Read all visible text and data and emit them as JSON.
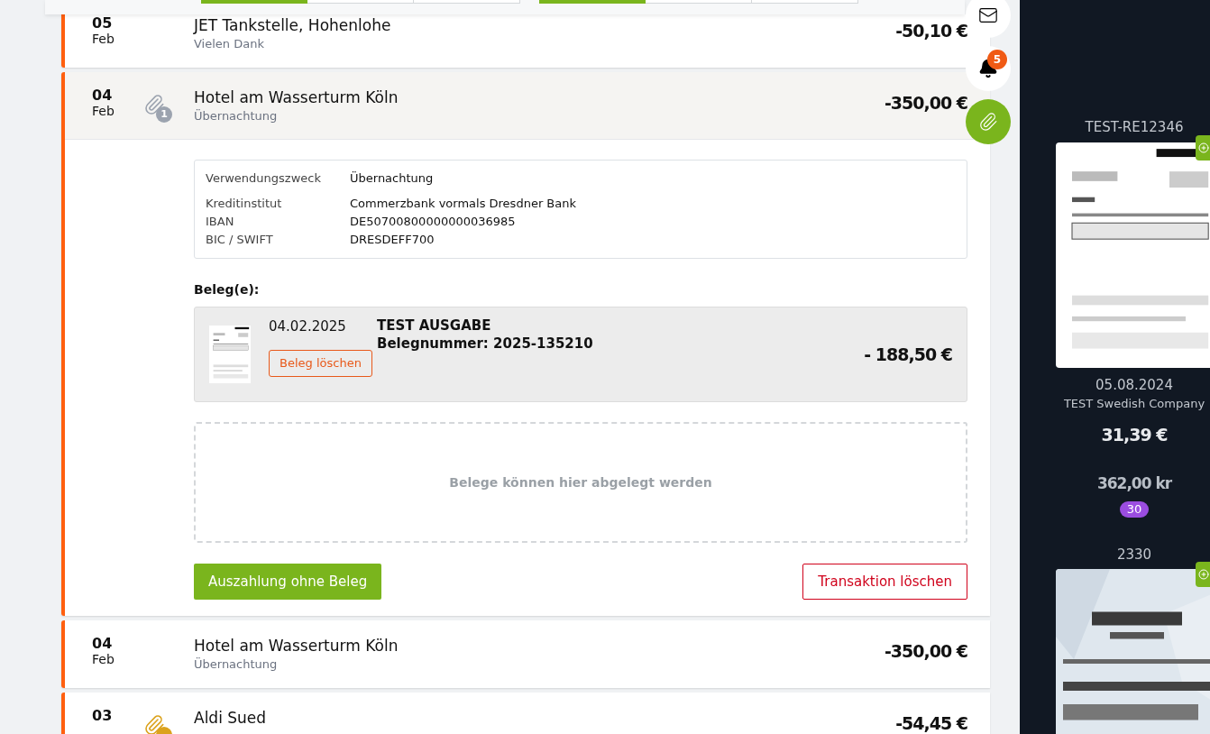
{
  "toolbar": {
    "groups": [
      {
        "segments": [
          {
            "selected": true
          },
          {
            "selected": false
          },
          {
            "selected": false
          }
        ]
      },
      {
        "segments": [
          {
            "selected": true
          },
          {
            "selected": false
          },
          {
            "selected": false
          }
        ]
      }
    ]
  },
  "transactions": [
    {
      "kind": "collapsed",
      "day": "05",
      "month": "Feb",
      "title": "JET Tankstelle, Hohenlohe",
      "subtitle": "Vielen Dank",
      "amount": "-50,10 €"
    },
    {
      "kind": "expanded",
      "day": "04",
      "month": "Feb",
      "title": "Hotel am Wasserturm Köln",
      "subtitle": "Übernachtung",
      "amount": "-350,00 €",
      "attachment": {
        "count": "1",
        "color": "#9ca3af"
      },
      "details": [
        {
          "label": "Verwendungszweck",
          "value": "Übernachtung"
        },
        {
          "label": "Kreditinstitut",
          "value": "Commerzbank vormals Dresdner Bank"
        },
        {
          "label": "IBAN",
          "value": "DE50700800000000036985"
        },
        {
          "label": "BIC / SWIFT",
          "value": "DRESDEFF700"
        }
      ],
      "receipts_label": "Beleg(e):",
      "receipts": [
        {
          "date": "04.02.2025",
          "title": "TEST AUSGABE",
          "number": "Belegnummer: 2025-135210",
          "amount": "- 188,50 €",
          "delete": "Beleg löschen"
        }
      ],
      "dropzone": "Belege können hier abgelegt werden",
      "primary_action": "Auszahlung ohne Beleg",
      "danger_action": "Transaktion löschen"
    },
    {
      "kind": "collapsed",
      "day": "04",
      "month": "Feb",
      "title": "Hotel am Wasserturm Köln",
      "subtitle": "Übernachtung",
      "amount": "-350,00 €"
    },
    {
      "kind": "collapsed",
      "day": "03",
      "title": "Aldi Sued",
      "amount": "-54,45 €",
      "attachment": {
        "color": "#dba21c"
      }
    }
  ],
  "side_actions": [
    {
      "kind": "mail",
      "selected": false
    },
    {
      "kind": "bell",
      "selected": false,
      "badge": "5"
    },
    {
      "kind": "attach",
      "selected": true
    }
  ],
  "inbox": [
    {
      "kind": "document",
      "title": "TEST-RE12346",
      "date": "05.08.2024",
      "vendor": "TEST Swedish Company",
      "amount": "31,39 €",
      "foreign_amount": "362,00 kr",
      "badge": "30"
    },
    {
      "title": "2330"
    }
  ]
}
